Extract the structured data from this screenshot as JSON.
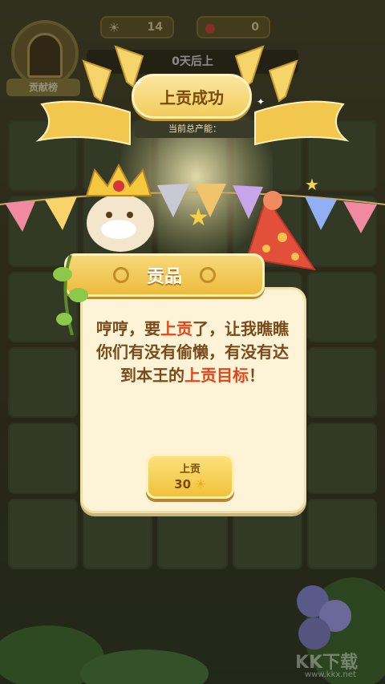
{
  "top": {
    "counter_sun": "14",
    "counter_mushroom": "0",
    "rank_label": "贡献榜",
    "day_text": "0天后上",
    "current_production": "当前总产能："
  },
  "title": "上贡成功",
  "panel": {
    "header": "贡品",
    "message_parts": [
      "哼哼，要",
      "上贡",
      "了，让我瞧瞧你们有没有偷懒，有没有达到本王的",
      "上贡目标",
      "！"
    ],
    "button_label": "上贡",
    "button_amount": "30"
  },
  "watermark": {
    "main": "KK下载",
    "small": "www.kkx.net"
  },
  "colors": {
    "highlight": "#e2461a",
    "text": "#7a4a1a",
    "gold": "#f2c13c"
  },
  "icons": [
    "sun-icon",
    "mushroom-icon",
    "door-icon",
    "horn-icon",
    "crown-icon",
    "party-hat-icon",
    "star-icon"
  ]
}
